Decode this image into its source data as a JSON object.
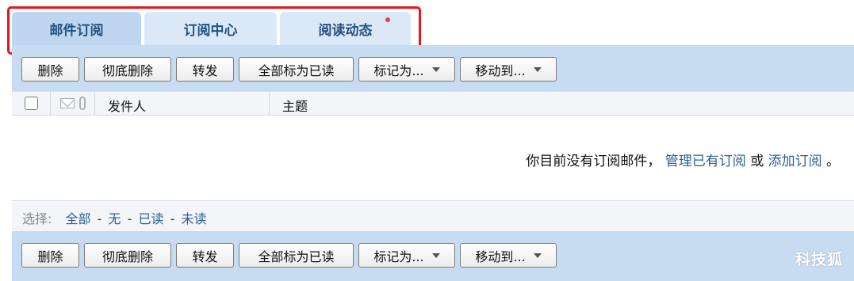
{
  "tabs": [
    {
      "label": "邮件订阅",
      "active": true
    },
    {
      "label": "订阅中心",
      "active": false
    },
    {
      "label": "阅读动态",
      "active": false,
      "has_notification_dot": true
    }
  ],
  "toolbar": {
    "delete": "删除",
    "purge": "彻底删除",
    "forward": "转发",
    "mark_all_read": "全部标为已读",
    "mark_as": "标记为...",
    "move_to": "移动到..."
  },
  "list_header": {
    "icons": [
      "mail-icon",
      "attachment-icon"
    ],
    "sender": "发件人",
    "subject": "主题"
  },
  "empty_message": {
    "text_before": "你目前没有订阅邮件，",
    "manage_link": "管理已有订阅",
    "or": "或",
    "add_link": "添加订阅",
    "end": "。"
  },
  "selection": {
    "label": "选择:",
    "all": "全部",
    "none": "无",
    "read": "已读",
    "unread": "未读"
  },
  "watermark": "科技狐",
  "colors": {
    "tab_text": "#23527f",
    "toolbar_bg": "#c7dbf1",
    "highlight": "#e8141b",
    "link": "#2c5f94",
    "dot": "#e4462b"
  }
}
